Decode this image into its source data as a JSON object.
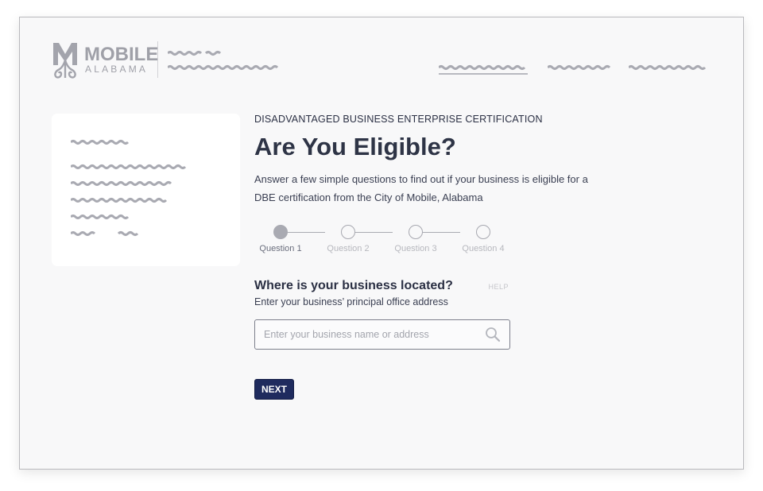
{
  "brand": {
    "wordmark": "MOBILE",
    "subline": "ALABAMA",
    "logo_icon": "mobile-seal-icon",
    "color": "#9fa0a8"
  },
  "header": {
    "nav_items": [
      {
        "active": true
      },
      {
        "active": false
      },
      {
        "active": false
      }
    ]
  },
  "main": {
    "eyebrow": "DISADVANTAGED BUSINESS ENTERPRISE CERTIFICATION",
    "title": "Are You Eligible?",
    "lede": "Answer a few simple questions to find out if your business is eligible for a DBE certification from the City of Mobile, Alabama",
    "steps": [
      {
        "label": "Question 1",
        "active": true
      },
      {
        "label": "Question 2",
        "active": false
      },
      {
        "label": "Question 3",
        "active": false
      },
      {
        "label": "Question 4",
        "active": false
      }
    ],
    "question": {
      "title": "Where is your business located?",
      "help": "HELP",
      "subtitle": "Enter your business’ principal office address"
    },
    "search": {
      "placeholder": "Enter your business name or address",
      "value": "",
      "icon": "search-icon"
    },
    "next_label": "NEXT"
  },
  "colors": {
    "primary_button": "#1f2b5e",
    "page_background": "#f8f8f9",
    "text": "#2b3044"
  }
}
